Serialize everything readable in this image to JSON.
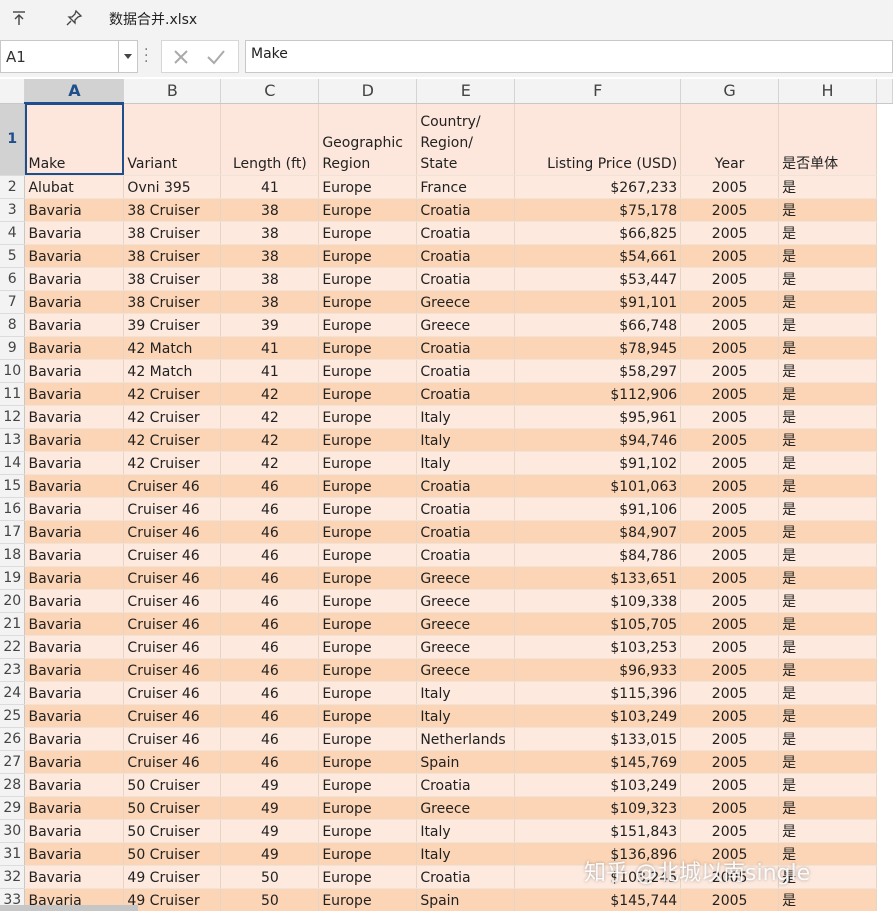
{
  "window": {
    "file_name": "数据合并.xlsx"
  },
  "formula_bar": {
    "cell_ref": "A1",
    "formula": "Make"
  },
  "columns": [
    "A",
    "B",
    "C",
    "D",
    "E",
    "F",
    "G",
    "H"
  ],
  "selected_column": "A",
  "header_row": {
    "row_number": "1",
    "make": "Make",
    "variant": "Variant",
    "length": "Length (ft)",
    "region": "Geographic Region",
    "country": "Country/ Region/ State",
    "price": "Listing Price (USD)",
    "year": "Year",
    "single": "是否单体"
  },
  "rows": [
    {
      "n": "2",
      "make": "Alubat",
      "variant": "Ovni 395",
      "length": "41",
      "region": "Europe",
      "country": "France",
      "price": "$267,233",
      "year": "2005",
      "single": "是"
    },
    {
      "n": "3",
      "make": "Bavaria",
      "variant": "38 Cruiser",
      "length": "38",
      "region": "Europe",
      "country": "Croatia",
      "price": "$75,178",
      "year": "2005",
      "single": "是"
    },
    {
      "n": "4",
      "make": "Bavaria",
      "variant": "38 Cruiser",
      "length": "38",
      "region": "Europe",
      "country": "Croatia",
      "price": "$66,825",
      "year": "2005",
      "single": "是"
    },
    {
      "n": "5",
      "make": "Bavaria",
      "variant": "38 Cruiser",
      "length": "38",
      "region": "Europe",
      "country": "Croatia",
      "price": "$54,661",
      "year": "2005",
      "single": "是"
    },
    {
      "n": "6",
      "make": "Bavaria",
      "variant": "38 Cruiser",
      "length": "38",
      "region": "Europe",
      "country": "Croatia",
      "price": "$53,447",
      "year": "2005",
      "single": "是"
    },
    {
      "n": "7",
      "make": "Bavaria",
      "variant": "38 Cruiser",
      "length": "38",
      "region": "Europe",
      "country": "Greece",
      "price": "$91,101",
      "year": "2005",
      "single": "是"
    },
    {
      "n": "8",
      "make": "Bavaria",
      "variant": "39 Cruiser",
      "length": "39",
      "region": "Europe",
      "country": "Greece",
      "price": "$66,748",
      "year": "2005",
      "single": "是"
    },
    {
      "n": "9",
      "make": "Bavaria",
      "variant": "42 Match",
      "length": "41",
      "region": "Europe",
      "country": "Croatia",
      "price": "$78,945",
      "year": "2005",
      "single": "是"
    },
    {
      "n": "10",
      "make": "Bavaria",
      "variant": "42 Match",
      "length": "41",
      "region": "Europe",
      "country": "Croatia",
      "price": "$58,297",
      "year": "2005",
      "single": "是"
    },
    {
      "n": "11",
      "make": "Bavaria",
      "variant": "42 Cruiser",
      "length": "42",
      "region": "Europe",
      "country": "Croatia",
      "price": "$112,906",
      "year": "2005",
      "single": "是"
    },
    {
      "n": "12",
      "make": "Bavaria",
      "variant": "42 Cruiser",
      "length": "42",
      "region": "Europe",
      "country": "Italy",
      "price": "$95,961",
      "year": "2005",
      "single": "是"
    },
    {
      "n": "13",
      "make": "Bavaria",
      "variant": "42 Cruiser",
      "length": "42",
      "region": "Europe",
      "country": "Italy",
      "price": "$94,746",
      "year": "2005",
      "single": "是"
    },
    {
      "n": "14",
      "make": "Bavaria",
      "variant": "42 Cruiser",
      "length": "42",
      "region": "Europe",
      "country": "Italy",
      "price": "$91,102",
      "year": "2005",
      "single": "是"
    },
    {
      "n": "15",
      "make": "Bavaria",
      "variant": "Cruiser 46",
      "length": "46",
      "region": "Europe",
      "country": "Croatia",
      "price": "$101,063",
      "year": "2005",
      "single": "是"
    },
    {
      "n": "16",
      "make": "Bavaria",
      "variant": "Cruiser 46",
      "length": "46",
      "region": "Europe",
      "country": "Croatia",
      "price": "$91,106",
      "year": "2005",
      "single": "是"
    },
    {
      "n": "17",
      "make": "Bavaria",
      "variant": "Cruiser 46",
      "length": "46",
      "region": "Europe",
      "country": "Croatia",
      "price": "$84,907",
      "year": "2005",
      "single": "是"
    },
    {
      "n": "18",
      "make": "Bavaria",
      "variant": "Cruiser 46",
      "length": "46",
      "region": "Europe",
      "country": "Croatia",
      "price": "$84,786",
      "year": "2005",
      "single": "是"
    },
    {
      "n": "19",
      "make": "Bavaria",
      "variant": "Cruiser 46",
      "length": "46",
      "region": "Europe",
      "country": "Greece",
      "price": "$133,651",
      "year": "2005",
      "single": "是"
    },
    {
      "n": "20",
      "make": "Bavaria",
      "variant": "Cruiser 46",
      "length": "46",
      "region": "Europe",
      "country": "Greece",
      "price": "$109,338",
      "year": "2005",
      "single": "是"
    },
    {
      "n": "21",
      "make": "Bavaria",
      "variant": "Cruiser 46",
      "length": "46",
      "region": "Europe",
      "country": "Greece",
      "price": "$105,705",
      "year": "2005",
      "single": "是"
    },
    {
      "n": "22",
      "make": "Bavaria",
      "variant": "Cruiser 46",
      "length": "46",
      "region": "Europe",
      "country": "Greece",
      "price": "$103,253",
      "year": "2005",
      "single": "是"
    },
    {
      "n": "23",
      "make": "Bavaria",
      "variant": "Cruiser 46",
      "length": "46",
      "region": "Europe",
      "country": "Greece",
      "price": "$96,933",
      "year": "2005",
      "single": "是"
    },
    {
      "n": "24",
      "make": "Bavaria",
      "variant": "Cruiser 46",
      "length": "46",
      "region": "Europe",
      "country": "Italy",
      "price": "$115,396",
      "year": "2005",
      "single": "是"
    },
    {
      "n": "25",
      "make": "Bavaria",
      "variant": "Cruiser 46",
      "length": "46",
      "region": "Europe",
      "country": "Italy",
      "price": "$103,249",
      "year": "2005",
      "single": "是"
    },
    {
      "n": "26",
      "make": "Bavaria",
      "variant": "Cruiser 46",
      "length": "46",
      "region": "Europe",
      "country": "Netherlands",
      "price": "$133,015",
      "year": "2005",
      "single": "是"
    },
    {
      "n": "27",
      "make": "Bavaria",
      "variant": "Cruiser 46",
      "length": "46",
      "region": "Europe",
      "country": "Spain",
      "price": "$145,769",
      "year": "2005",
      "single": "是"
    },
    {
      "n": "28",
      "make": "Bavaria",
      "variant": "50 Cruiser",
      "length": "49",
      "region": "Europe",
      "country": "Croatia",
      "price": "$103,249",
      "year": "2005",
      "single": "是"
    },
    {
      "n": "29",
      "make": "Bavaria",
      "variant": "50 Cruiser",
      "length": "49",
      "region": "Europe",
      "country": "Greece",
      "price": "$109,323",
      "year": "2005",
      "single": "是"
    },
    {
      "n": "30",
      "make": "Bavaria",
      "variant": "50 Cruiser",
      "length": "49",
      "region": "Europe",
      "country": "Italy",
      "price": "$151,843",
      "year": "2005",
      "single": "是"
    },
    {
      "n": "31",
      "make": "Bavaria",
      "variant": "50 Cruiser",
      "length": "49",
      "region": "Europe",
      "country": "Italy",
      "price": "$136,896",
      "year": "2005",
      "single": "是"
    },
    {
      "n": "32",
      "make": "Bavaria",
      "variant": "49 Cruiser",
      "length": "50",
      "region": "Europe",
      "country": "Croatia",
      "price": "$103,245",
      "year": "2005",
      "single": "是"
    },
    {
      "n": "33",
      "make": "Bavaria",
      "variant": "49 Cruiser",
      "length": "50",
      "region": "Europe",
      "country": "Spain",
      "price": "$145,744",
      "year": "2005",
      "single": "是"
    }
  ],
  "watermark": "知乎 @北城以南single",
  "colors": {
    "band_light": "#fde9de",
    "band_dark": "#fcd5b6",
    "selection": "#1e4e8c"
  }
}
